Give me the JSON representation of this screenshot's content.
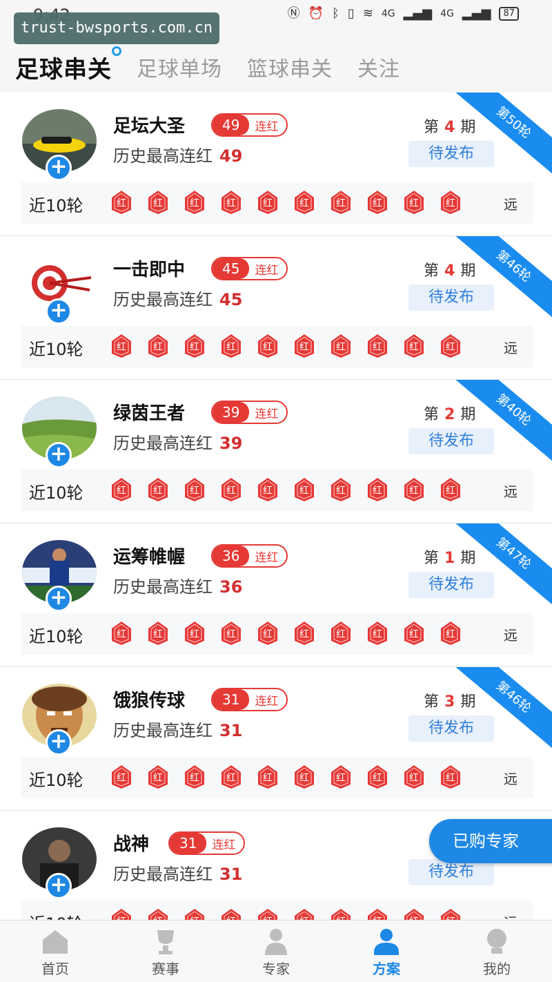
{
  "status_bar": {
    "time": "9:42",
    "battery": "87",
    "net1": "4G",
    "net2": "4G"
  },
  "url_overlay": "trust-bwsports.com.cn",
  "tabs": [
    {
      "label": "足球串关",
      "active": true
    },
    {
      "label": "足球单场",
      "active": false
    },
    {
      "label": "篮球串关",
      "active": false
    },
    {
      "label": "关注",
      "active": false
    }
  ],
  "common": {
    "history_prefix": "历史最高连红",
    "streak_suffix": "连红",
    "recent_label": "近10轮",
    "far_label": "远",
    "period_prefix": "第",
    "period_suffix": "期",
    "badge_char": "红",
    "follow_symbol": "+"
  },
  "experts": [
    {
      "name": "足坛大圣",
      "streak": "49",
      "history_max": "49",
      "period": "4",
      "status": "待发布",
      "ribbon": "第50轮",
      "avatar": "car"
    },
    {
      "name": "一击即中",
      "streak": "45",
      "history_max": "45",
      "period": "4",
      "status": "待发布",
      "ribbon": "第46轮",
      "avatar": "target"
    },
    {
      "name": "绿茵王者",
      "streak": "39",
      "history_max": "39",
      "period": "2",
      "status": "待发布",
      "ribbon": "第40轮",
      "avatar": "grass"
    },
    {
      "name": "运筹帷幄",
      "streak": "36",
      "history_max": "36",
      "period": "1",
      "status": "待发布",
      "ribbon": "第47轮",
      "avatar": "player"
    },
    {
      "name": "饿狼传球",
      "streak": "31",
      "history_max": "31",
      "period": "3",
      "status": "待发布",
      "ribbon": "第46轮",
      "avatar": "cartoon"
    },
    {
      "name": "战神",
      "streak": "31",
      "history_max": "31",
      "period": "",
      "status": "待发布",
      "ribbon": "",
      "avatar": "man"
    }
  ],
  "floating_button": "已购专家",
  "bottom_nav": [
    {
      "label": "首页",
      "icon": "home-icon",
      "active": false
    },
    {
      "label": "赛事",
      "icon": "trophy-icon",
      "active": false
    },
    {
      "label": "专家",
      "icon": "expert-icon",
      "active": false
    },
    {
      "label": "方案",
      "icon": "plan-icon",
      "active": true
    },
    {
      "label": "我的",
      "icon": "profile-icon",
      "active": false
    }
  ],
  "colors": {
    "accent": "#1e88e5",
    "red": "#e53935",
    "ribbon": "#1a8cf0"
  }
}
